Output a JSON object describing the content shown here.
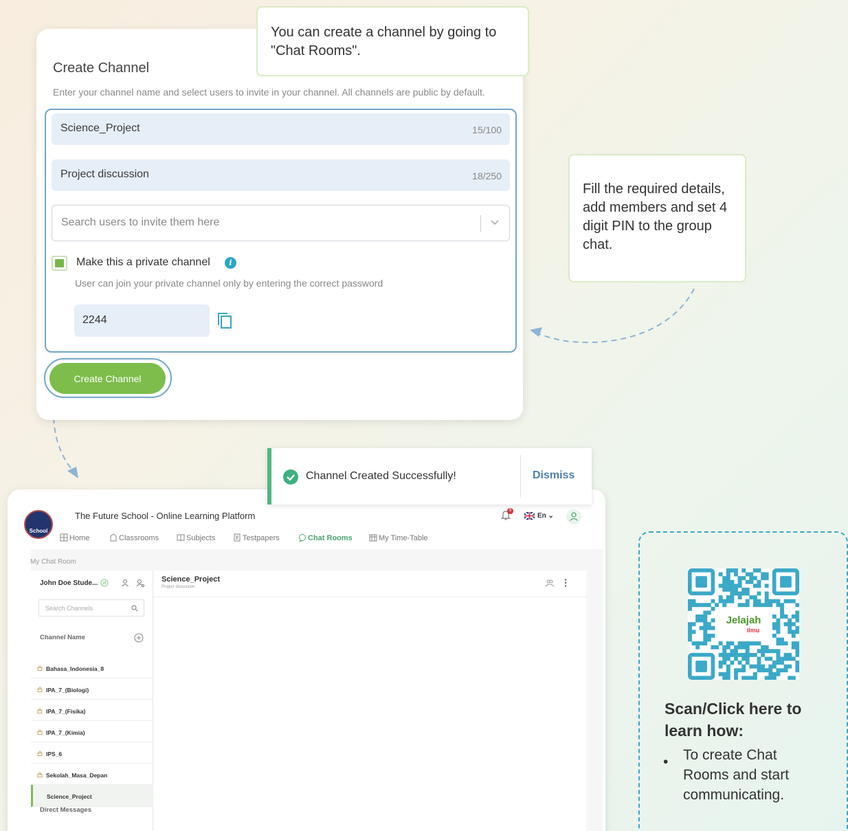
{
  "create_channel": {
    "title": "Create Channel",
    "subtitle": "Enter your channel name and select users to invite in your channel. All channels are public by default.",
    "channel_name": {
      "value": "Science_Project",
      "count": "15/100"
    },
    "description": {
      "value": "Project discussion",
      "count": "18/250"
    },
    "invite_placeholder": "Search users to invite them here",
    "private_label": "Make this a private channel",
    "private_help": "User can join your private channel only by entering the correct password",
    "pin": "2244",
    "button_label": "Create Channel"
  },
  "tooltips": {
    "chat_rooms": "You can create a channel by going to \"Chat Rooms\".",
    "fill_details": "Fill the required details, add members and set 4 digit PIN to the group chat."
  },
  "toast": {
    "message": "Channel Created Successfully!",
    "dismiss": "Dismiss"
  },
  "app": {
    "logo_text": "School",
    "title": "The Future School - Online Learning Platform",
    "nav": [
      "Home",
      "Classrooms",
      "Subjects",
      "Testpapers",
      "Chat Rooms",
      "My Time-Table"
    ],
    "active_nav": "Chat Rooms",
    "notification_count": "9",
    "language": "En",
    "breadcrumb": "My Chat Room",
    "user_name": "John Doe Stude...",
    "search_placeholder": "Search Channels",
    "channel_header": "Channel Name",
    "channels": [
      "Bahasa_Indonesia_8",
      "IPA_7_(Biologi)",
      "IPA_7_(Fisika)",
      "IPA_7_(Kimia)",
      "IPS_6",
      "Sekolah_Masa_Depan",
      "Science_Project"
    ],
    "active_channel": "Science_Project",
    "direct_messages": "Direct Messages",
    "chat_title": "Science_Project",
    "chat_subtitle": "Project discussion"
  },
  "qr_panel": {
    "logo_text_1": "Jelajah",
    "logo_text_2": "ilmu",
    "title": "Scan/Click here to learn how:",
    "bullet": "To create Chat Rooms and start communicating."
  },
  "colors": {
    "accent_green": "#7cbd4b",
    "border_blue": "#6fa7c8",
    "toast_green": "#51b77e",
    "qr_teal": "#3ba9c8"
  }
}
